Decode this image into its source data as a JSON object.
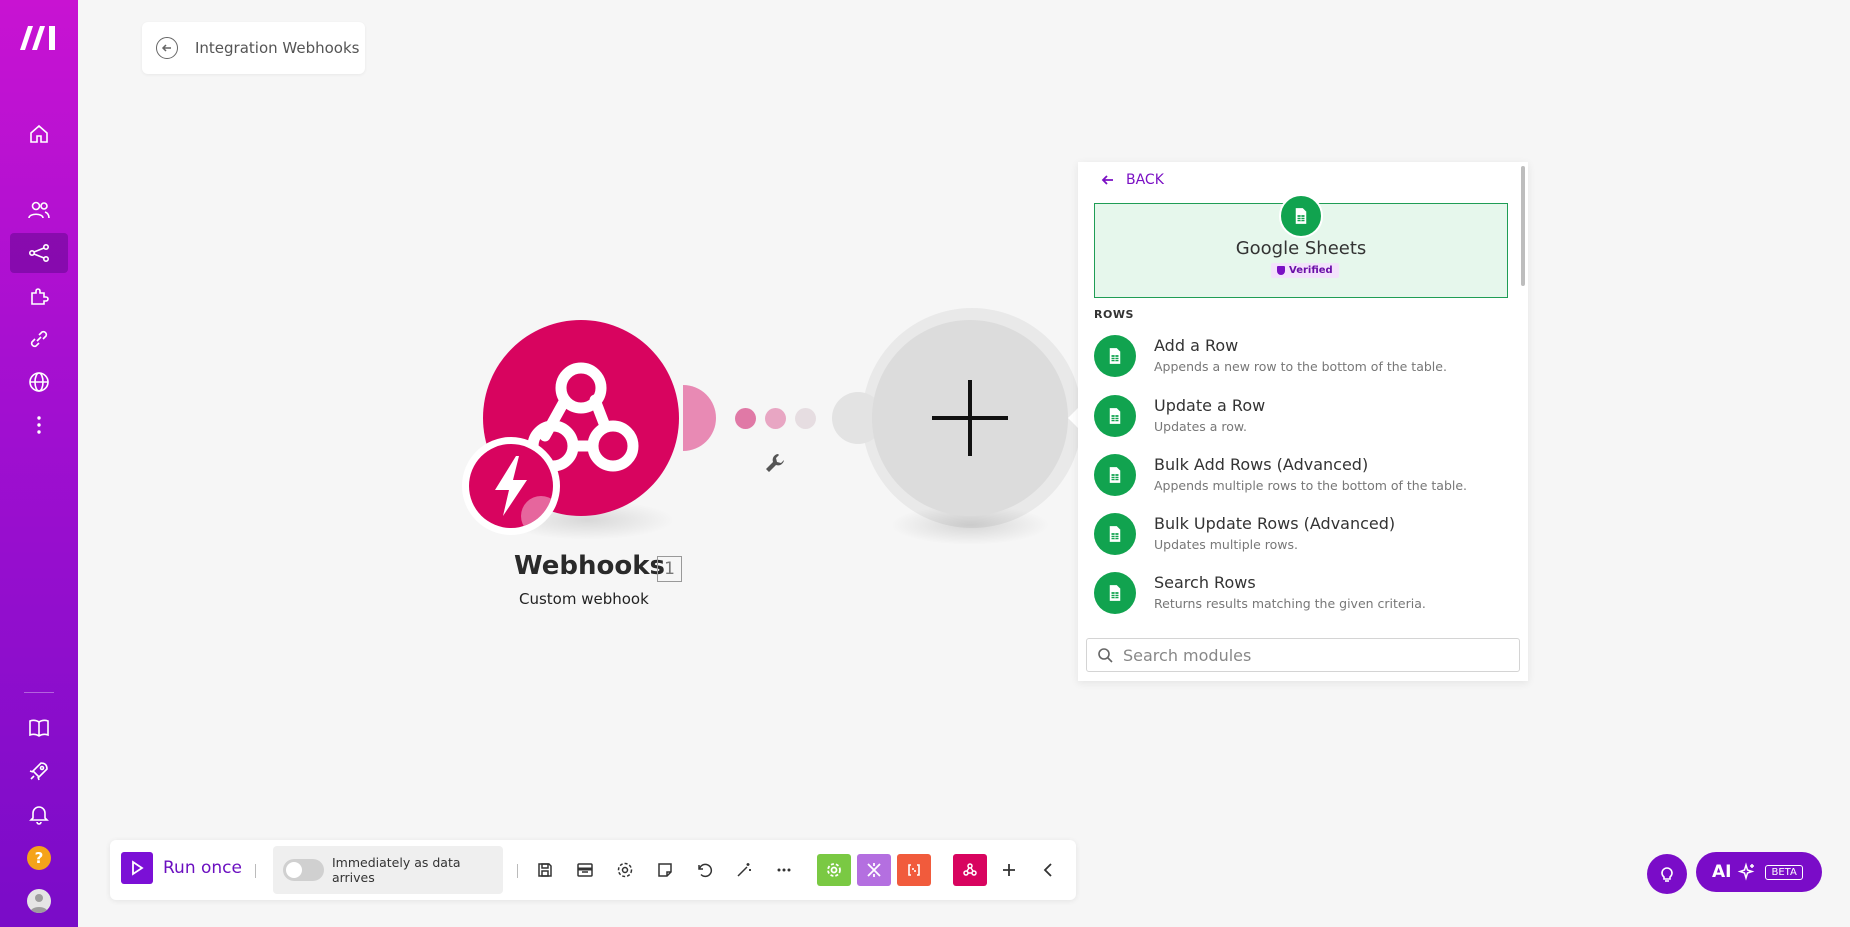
{
  "breadcrumb": {
    "title": "Integration Webhooks"
  },
  "module": {
    "title": "Webhooks",
    "count": "1",
    "subtitle": "Custom webhook"
  },
  "panel": {
    "back_label": "BACK",
    "app_name": "Google Sheets",
    "verified_label": "Verified",
    "section_label": "ROWS",
    "items": [
      {
        "name": "Add a Row",
        "desc": "Appends a new row to the bottom of the table."
      },
      {
        "name": "Update a Row",
        "desc": "Updates a row."
      },
      {
        "name": "Bulk Add Rows (Advanced)",
        "desc": "Appends multiple rows to the bottom of the table."
      },
      {
        "name": "Bulk Update Rows (Advanced)",
        "desc": "Updates multiple rows."
      },
      {
        "name": "Search Rows",
        "desc": "Returns results matching the given criteria."
      }
    ],
    "search_placeholder": "Search modules"
  },
  "toolbar": {
    "run_label": "Run once",
    "schedule_label": "Immediately as data arrives"
  },
  "ai": {
    "label": "AI",
    "beta": "BETA"
  },
  "colors": {
    "sidebar_top": "#c813d2",
    "sidebar_bottom": "#7a0cc8",
    "webhook": "#d8045f",
    "sheets_green": "#11a34f",
    "accent_purple": "#7b10c4"
  },
  "icons": {
    "sidebar": [
      "home-icon",
      "team-icon",
      "scenarios-icon",
      "apps-icon",
      "connections-icon",
      "webhooks-icon",
      "more-icon",
      "docs-icon",
      "rocket-icon",
      "bell-icon",
      "help-icon",
      "avatar"
    ]
  }
}
